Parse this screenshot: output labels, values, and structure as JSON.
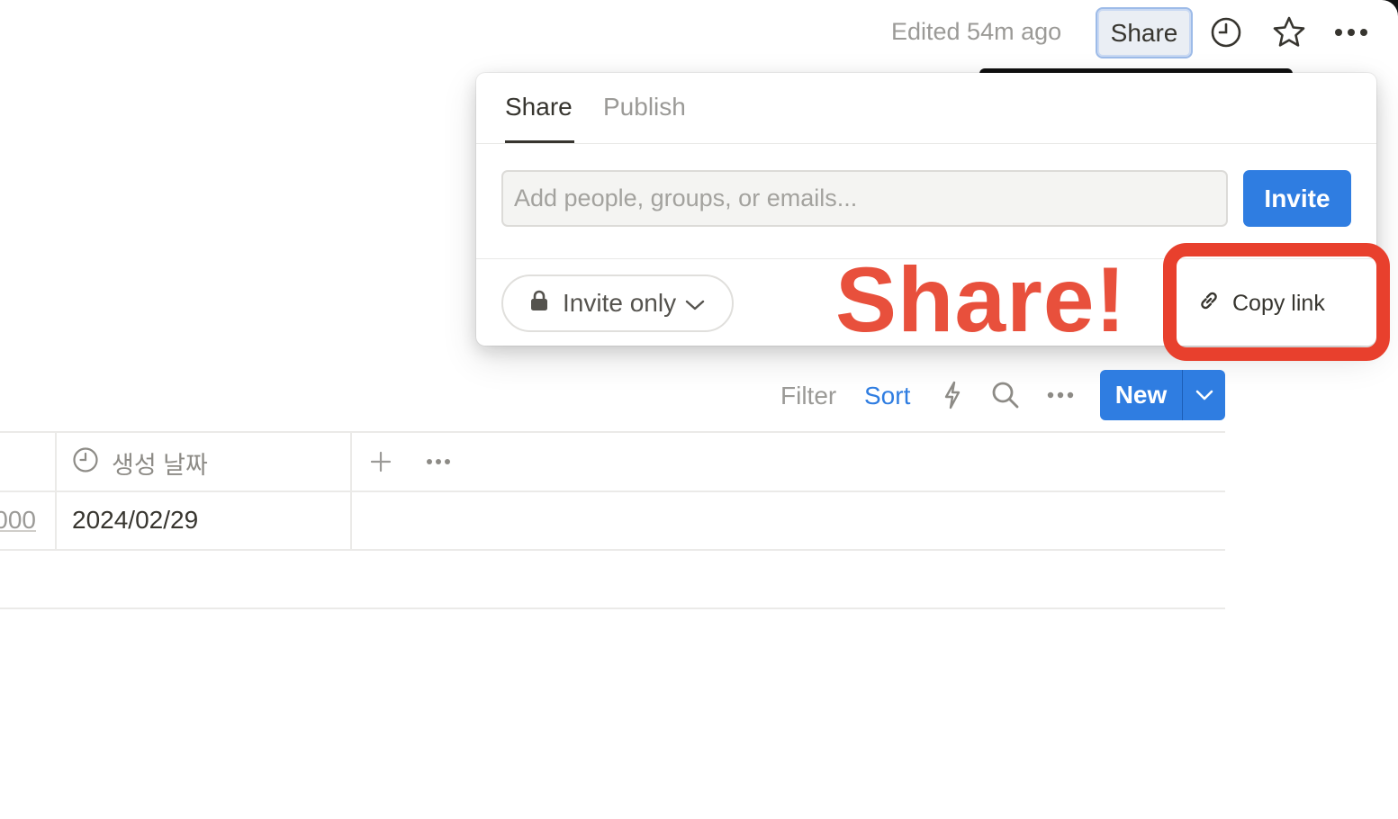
{
  "topbar": {
    "edited": "Edited 54m ago",
    "share_label": "Share",
    "icons": [
      "history-icon",
      "star-icon",
      "more-icon"
    ]
  },
  "share_popover": {
    "tabs": [
      {
        "label": "Share",
        "active": true
      },
      {
        "label": "Publish",
        "active": false
      }
    ],
    "invite_placeholder": "Add people, groups, or emails...",
    "invite_value": "",
    "invite_button": "Invite",
    "access_level": "Invite only",
    "copy_link": "Copy link"
  },
  "annotation": {
    "text": "Share!",
    "color": "#e8503c"
  },
  "db_toolbar": {
    "filter": "Filter",
    "sort": "Sort",
    "new": "New",
    "icons": [
      "lightning-icon",
      "search-icon",
      "more-icon",
      "chevron-down-icon"
    ]
  },
  "table": {
    "columns": [
      {
        "icon": "clock-icon",
        "label": "생성 날짜"
      }
    ],
    "rows": [
      {
        "partial_value": "000",
        "created_date": "2024/02/29"
      }
    ]
  },
  "colors": {
    "accent": "#2f7de1",
    "annotation_red": "#e8402d",
    "muted_text": "#9b9a97"
  }
}
